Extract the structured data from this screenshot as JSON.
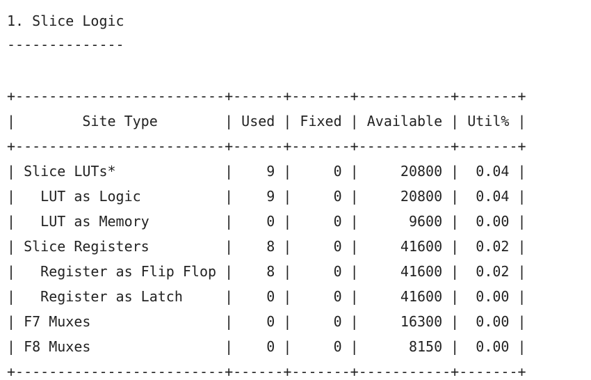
{
  "section": {
    "title": "1. Slice Logic",
    "underline": "--------------"
  },
  "table": {
    "border": "+-------------------------+------+-------+-----------+-------+",
    "header": [
      "Site Type",
      "Used",
      "Fixed",
      "Available",
      "Util%"
    ],
    "rows": [
      {
        "site_type": "Slice LUTs*",
        "indent": 0,
        "used": "9",
        "fixed": "0",
        "available": "20800",
        "util": "0.04"
      },
      {
        "site_type": "LUT as Logic",
        "indent": 1,
        "used": "9",
        "fixed": "0",
        "available": "20800",
        "util": "0.04"
      },
      {
        "site_type": "LUT as Memory",
        "indent": 1,
        "used": "0",
        "fixed": "0",
        "available": "9600",
        "util": "0.00"
      },
      {
        "site_type": "Slice Registers",
        "indent": 0,
        "used": "8",
        "fixed": "0",
        "available": "41600",
        "util": "0.02"
      },
      {
        "site_type": "Register as Flip Flop",
        "indent": 1,
        "used": "8",
        "fixed": "0",
        "available": "41600",
        "util": "0.02"
      },
      {
        "site_type": "Register as Latch",
        "indent": 1,
        "used": "0",
        "fixed": "0",
        "available": "41600",
        "util": "0.00"
      },
      {
        "site_type": "F7 Muxes",
        "indent": 0,
        "used": "0",
        "fixed": "0",
        "available": "16300",
        "util": "0.00"
      },
      {
        "site_type": "F8 Muxes",
        "indent": 0,
        "used": "0",
        "fixed": "0",
        "available": "8150",
        "util": "0.00"
      }
    ]
  }
}
